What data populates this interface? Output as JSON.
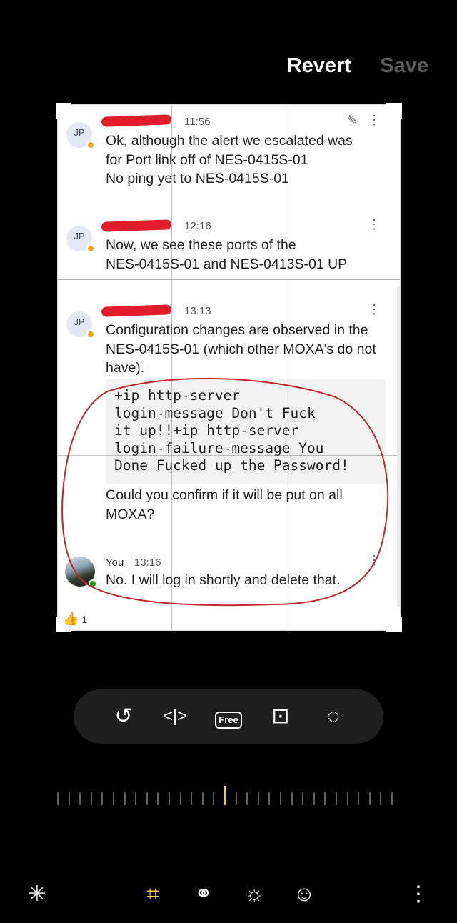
{
  "header": {
    "revert_label": "Revert",
    "save_label": "Save"
  },
  "messages": [
    {
      "initials": "JP",
      "time": "11:56",
      "lines": [
        "Ok, although the alert we escalated was",
        "for Port link off of NES-0415S-01",
        "No ping yet to NES-0415S-01"
      ]
    },
    {
      "initials": "JP",
      "time": "12:16",
      "lines": [
        "Now, we see these ports of the",
        "NES-0415S-01 and NES-0413S-01 UP"
      ]
    },
    {
      "initials": "JP",
      "time": "13:13",
      "lines": [
        "Configuration changes are observed in the",
        "NES-0415S-01 (which other MOXA's do not",
        "have)."
      ],
      "code": "+ip http-server\nlogin-message Don't Fuck\nit up!!+ip http-server\nlogin-failure-message You\nDone Fucked up the Password!",
      "after_lines": [
        "Could you confirm if it will be put on all",
        "MOXA?"
      ]
    },
    {
      "sender": "You",
      "time": "13:16",
      "lines": [
        "No. I will log in shortly and delete that."
      ]
    }
  ],
  "reaction": {
    "emoji": "👍",
    "count": "1"
  },
  "toolbar": {
    "free_label": "Free"
  },
  "icons": {
    "pencil": "edit-icon",
    "kebab": "more-options-icon",
    "rotate": "rotate-icon",
    "flip": "flip-icon",
    "free": "free-crop-icon",
    "aspect": "aspect-ratio-icon",
    "lasso": "lasso-icon",
    "auto": "auto-enhance-icon",
    "crop": "crop-icon",
    "filter": "filter-icon",
    "brightness": "brightness-icon",
    "sticker": "sticker-icon",
    "more": "more-icon"
  },
  "colors": {
    "accent": "#f7c940",
    "annotation": "#c0282a",
    "redaction": "#e21d2b"
  },
  "dial": {
    "position": 0.5
  }
}
